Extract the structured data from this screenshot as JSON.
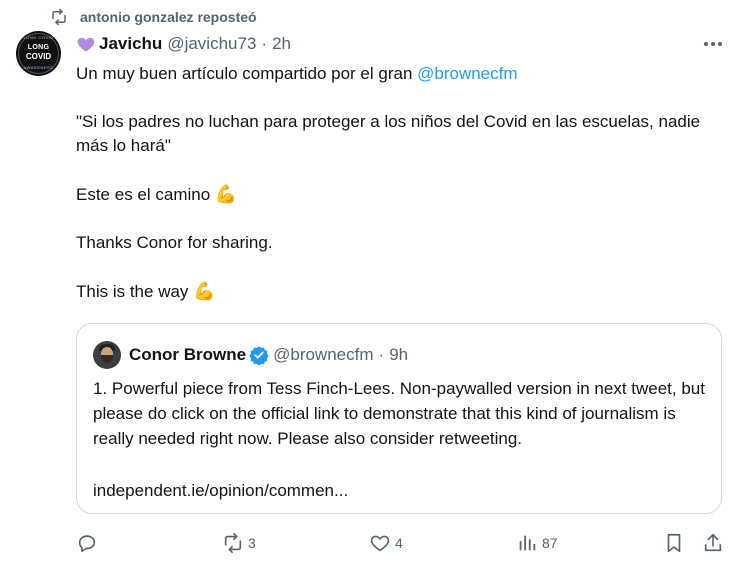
{
  "repost": {
    "text": "antonio gonzalez reposteó",
    "icon": "repost-icon"
  },
  "tweet": {
    "avatar_text": {
      "line1": "LONG",
      "line2": "COVID",
      "arc_top": "LONG COVID",
      "arc_bottom": "AWARENESS"
    },
    "name_emoji": "heart-icon",
    "author_name": "Javichu",
    "handle": "@javichu73",
    "separator": "·",
    "time": "2h",
    "paragraphs": {
      "p1_text": "Un muy buen artículo compartido por el gran ",
      "p1_mention": "@brownecfm",
      "p2": "\"Si los padres no luchan para proteger a los niños del Covid en las escuelas, nadie más lo hará\"",
      "p3": "Este es el camino ",
      "p4": "Thanks Conor for sharing.",
      "p5": "This is the way "
    },
    "emoji_flexed": "💪"
  },
  "quote": {
    "author_name": "Conor Browne",
    "handle": "@brownecfm",
    "separator": "·",
    "time": "9h",
    "text": "1. Powerful piece from Tess Finch-Lees. Non-paywalled version in next tweet, but please do click on the official link to demonstrate that this kind of journalism is really needed right now. Please also consider retweeting.",
    "link": "independent.ie/opinion/commen..."
  },
  "actions": {
    "retweets": "3",
    "likes": "4",
    "views": "87"
  },
  "colors": {
    "accent": "#1d9bf0",
    "muted": "#536471",
    "text": "#0f1419",
    "border": "#cfd9de",
    "heart": "#b18be0"
  }
}
